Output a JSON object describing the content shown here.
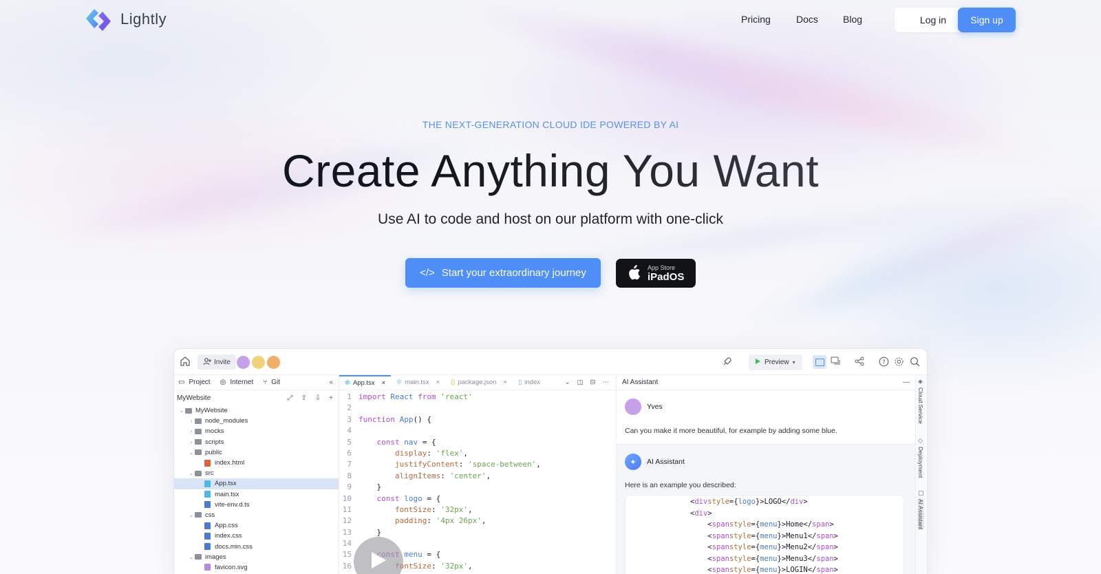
{
  "nav": {
    "brand": "Lightly",
    "links": [
      "Pricing",
      "Docs",
      "Blog"
    ],
    "login_label": "Log in",
    "signup_label": "Sign up"
  },
  "hero": {
    "eyebrow": "THE NEXT-GENERATION CLOUD IDE POWERED BY AI",
    "headline": "Create Anything You Want",
    "subline": "Use AI to code and host on our platform with one-click",
    "cta_icon": "</>",
    "cta_label": "Start your extraordinary journey",
    "store_small": "App Store",
    "store_big": "iPadOS"
  },
  "ide": {
    "invite_label": "Invite",
    "preview_label": "Preview",
    "left_tabs": [
      "Project",
      "Internet",
      "Git"
    ],
    "project_name": "MyWebsite",
    "tree": [
      {
        "label": "MyWebsite",
        "type": "folder",
        "open": true
      },
      {
        "label": "node_modules",
        "type": "folder"
      },
      {
        "label": "mocks",
        "type": "folder"
      },
      {
        "label": "scripts",
        "type": "folder"
      },
      {
        "label": "public",
        "type": "folder",
        "open": true
      },
      {
        "label": "index.html",
        "type": "html"
      },
      {
        "label": "src",
        "type": "folder",
        "open": true
      },
      {
        "label": "App.tsx",
        "type": "react",
        "selected": true
      },
      {
        "label": "main.tsx",
        "type": "react"
      },
      {
        "label": "vite-env.d.ts",
        "type": "ts"
      },
      {
        "label": "css",
        "type": "folder",
        "open": true
      },
      {
        "label": "App.css",
        "type": "css"
      },
      {
        "label": "index.css",
        "type": "css"
      },
      {
        "label": "docs.min.css",
        "type": "css"
      },
      {
        "label": "images",
        "type": "folder",
        "open": true
      },
      {
        "label": "favicon.svg",
        "type": "img"
      }
    ],
    "code_tabs": [
      "App.tsx",
      "main.tsx",
      "package.json",
      "index"
    ],
    "code_lines": [
      "import React from 'react'",
      "",
      "function App() {",
      "",
      "    const nav = {",
      "        display: 'flex',",
      "        justifyContent: 'space-between',",
      "        alignItems: 'center',",
      "    }",
      "    const logo = {",
      "        fontSize: '32px',",
      "        padding: '4px 26px',",
      "    }",
      "",
      "    const menu = {",
      "        fontSize: '32px',"
    ],
    "ai": {
      "title": "AI Assistant",
      "user_name": "Yves",
      "user_message": "Can you make it more beautiful, for example by adding some blue.",
      "bot_name": "AI Assistant",
      "bot_message": "Here is an example you described:",
      "snippet": [
        "<div style={logo}>LOGO</div>",
        "<div>",
        "    <span style={menu}>Home</span>",
        "    <span style={menu}>Menu1</span>",
        "    <span style={menu}>Menu2</span>",
        "    <span style={menu}>Menu3</span>",
        "    <span style={menu}>LOGIN</span>"
      ],
      "side_tabs": [
        "Cloud Service",
        "Deployment",
        "AI Assistant"
      ]
    }
  },
  "colors": {
    "accent": "#4f8ef7",
    "dark_button": "#111317",
    "eyebrow": "#5b8fe8"
  }
}
